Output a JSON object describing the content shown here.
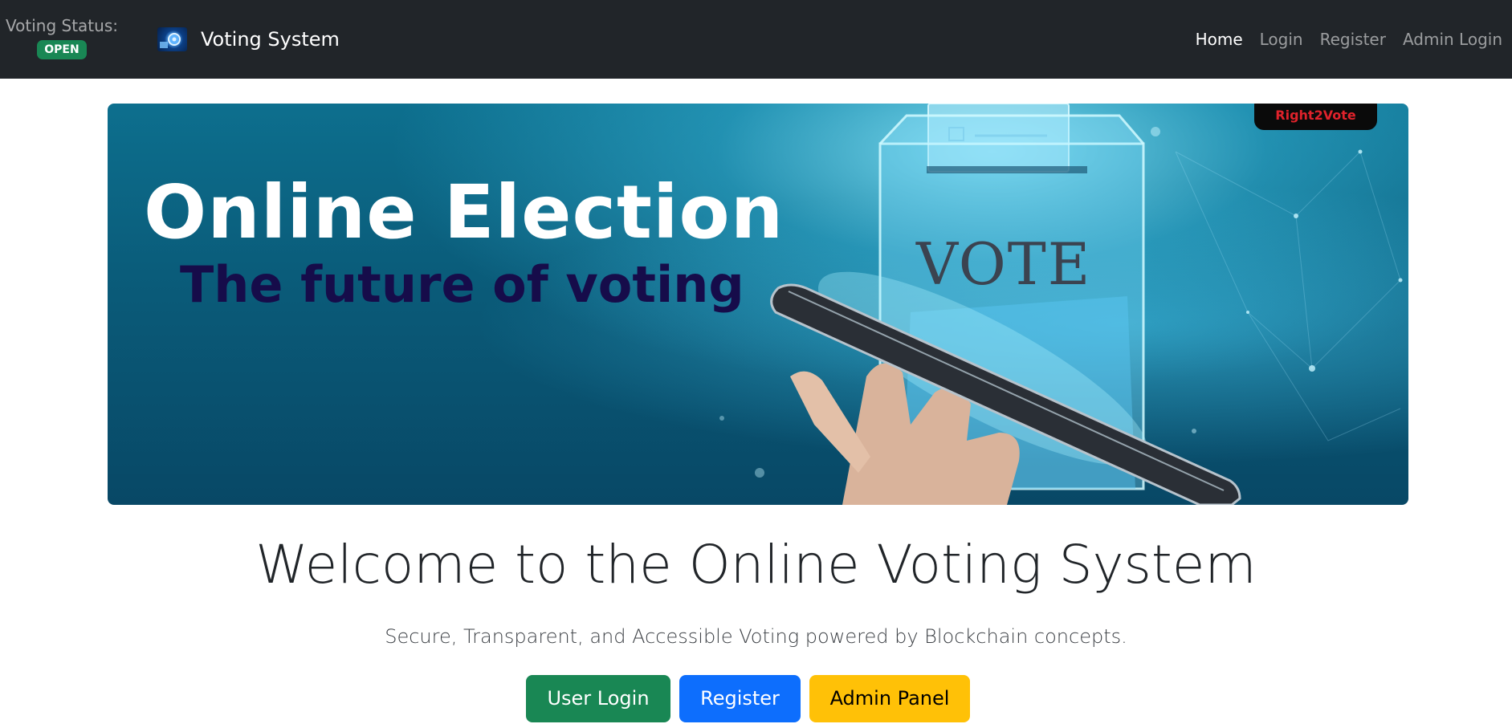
{
  "navbar": {
    "status_label": "Voting Status:",
    "status_value": "OPEN",
    "brand_name": "Voting System",
    "links": [
      {
        "label": "Home",
        "active": true
      },
      {
        "label": "Login",
        "active": false
      },
      {
        "label": "Register",
        "active": false
      },
      {
        "label": "Admin Login",
        "active": false
      }
    ]
  },
  "banner": {
    "headline": "Online Election",
    "subheadline": "The future of voting",
    "ballot_box_text": "VOTE",
    "logo_badge_text": "Right2Vote"
  },
  "main": {
    "title": "Welcome to the Online Voting System",
    "lead": "Secure, Transparent, and Accessible Voting powered by Blockchain concepts.",
    "buttons": {
      "user_login": "User Login",
      "register": "Register",
      "admin_panel": "Admin Panel"
    }
  },
  "colors": {
    "navbar_bg": "#212529",
    "status_open": "#198754",
    "success": "#198754",
    "primary": "#0d6efd",
    "warning": "#ffc107"
  },
  "icons": {
    "brand_logo": "ballot-globe-logo-icon"
  }
}
